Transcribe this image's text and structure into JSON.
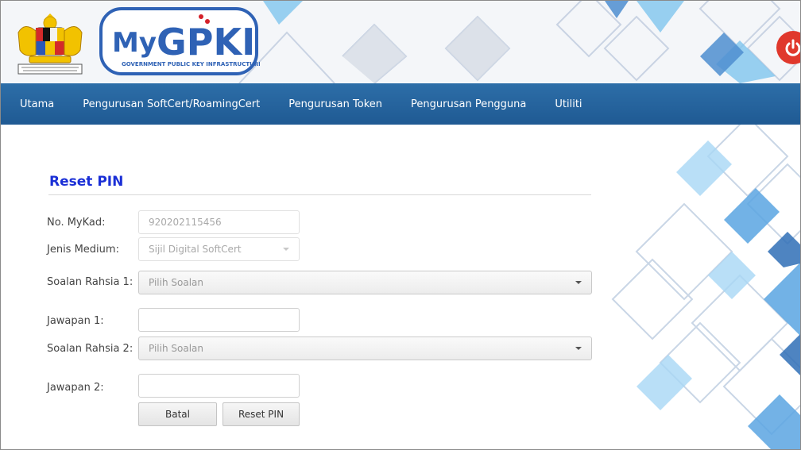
{
  "header": {
    "logo_text": "MyGPKI",
    "logo_subtitle": "GOVERNMENT PUBLIC KEY INFRASTRUCTURE",
    "power_icon": "power-icon",
    "colors": {
      "nav": "#1f5a93",
      "logo_blue": "#2f62b5",
      "power_red": "#e0382c",
      "title_blue": "#1a2fd6"
    }
  },
  "nav": {
    "items": [
      {
        "label": "Utama"
      },
      {
        "label": "Pengurusan SoftCert/RoamingCert"
      },
      {
        "label": "Pengurusan Token"
      },
      {
        "label": "Pengurusan Pengguna"
      },
      {
        "label": "Utiliti"
      }
    ]
  },
  "form": {
    "title": "Reset PIN",
    "mykad_label": "No. MyKad:",
    "mykad_value": "920202115456",
    "medium_label": "Jenis Medium:",
    "medium_value": "Sijil Digital SoftCert",
    "q1_label": "Soalan Rahsia 1:",
    "q1_value": "Pilih Soalan",
    "a1_label": "Jawapan 1:",
    "a1_value": "",
    "q2_label": "Soalan Rahsia 2:",
    "q2_value": "Pilih Soalan",
    "a2_label": "Jawapan 2:",
    "a2_value": "",
    "cancel_label": "Batal",
    "submit_label": "Reset PIN"
  }
}
